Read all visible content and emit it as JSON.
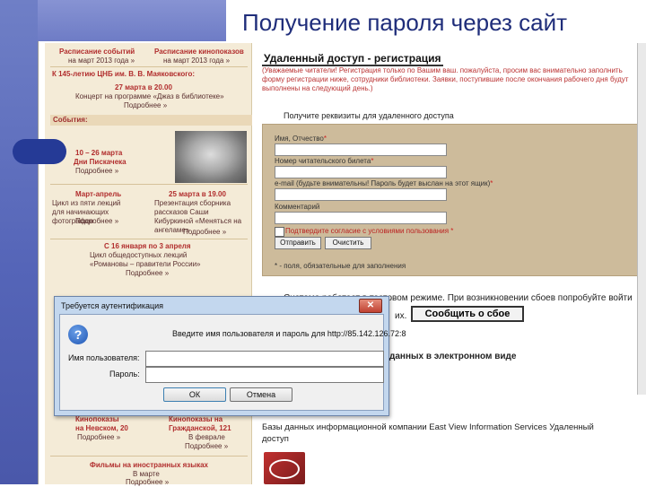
{
  "slide": {
    "title": "Получение пароля через сайт"
  },
  "sidebar": {
    "top_left": "Расписание событий",
    "top_left_sub": "на март 2013 года »",
    "top_right": "Расписание кинопоказов",
    "top_right_sub": "на март 2013 года »",
    "anniversary": "К 145-летию ЦНБ им. В. В. Маяковского:",
    "event1_date": "27 марта в 20.00",
    "event1_desc": "Концерт на программе «Джаз в библиотеке»",
    "more": "Подробнее »",
    "events_head": "События:",
    "event2_date": "10 – 26 марта",
    "event2_name": "Дни Пискачека",
    "event3_date": "Март-апрель",
    "event3_desc": "Цикл из пяти лекций для начинающих фотографов",
    "event4_date": "25 марта в 19.00",
    "event4_desc": "Презентация сборника рассказов Саши Кибуркиной «Меняться на ангеламе»",
    "event5_date": "С 16 января по 3 апреля",
    "event5_desc": "Цикл общедоступных лекций «Романовы – правители России»",
    "cinema1": "Кинопоказы на Невском, 20",
    "cinema2": "Кинопоказы на Гражданской, 121",
    "cinema2_sub": "В феврале",
    "films_foreign": "Фильмы на иностранных языках",
    "films_sub": "В марте"
  },
  "registration": {
    "title": "Удаленный доступ - регистрация",
    "notice": "(Уважаемые читатели! Регистрация только по Вашим ваш. пожалуйста, просим вас внимательно заполнить форму регистрации ниже, сотрудники библиотеки. Заявки, поступившие после окончания рабочего дня будут выполнены на следующий день.)",
    "get_requisites": "Получите реквизиты для удаленного доступа",
    "fields": [
      {
        "label": "Имя, Отчество",
        "required": "*"
      },
      {
        "label": "Номер читательского билета",
        "required": "*"
      },
      {
        "label": "e-mail (будьте внимательны! Пароль будет выслан на этот ящик)",
        "required": "*"
      },
      {
        "label": "Комментарий",
        "required": ""
      }
    ],
    "agree_label": "Подтвердите согласие с условиями пользования",
    "agree_required": "*",
    "send_button": "Отправить",
    "clear_button": "Очистить",
    "required_note": "* - поля, обязательные для заполнения"
  },
  "lower": {
    "test_mode_line1": "Система работает в тестовом режиме. При возникновении сбоев попробуйте войти",
    "test_mode_line2": "их.",
    "report_button": "Сообщить о сбое",
    "electronic": "данных в электронном виде",
    "eastview": "Базы данных информационной компании East View Information Services Удаленный доступ"
  },
  "auth_dialog": {
    "title": "Требуется аутентификация",
    "message": "Введите имя пользователя и пароль для http://85.142.126.72:8",
    "user_label": "Имя пользователя:",
    "password_label": "Пароль:",
    "ok_button": "ОК",
    "cancel_button": "Отмена",
    "username_value": "",
    "password_value": ""
  },
  "colors": {
    "slide_band": "#5565b8",
    "sidebar_bg": "#f4ebd7",
    "form_bg": "#cdbb9b",
    "dialog_frame": "#c3d7ee"
  }
}
